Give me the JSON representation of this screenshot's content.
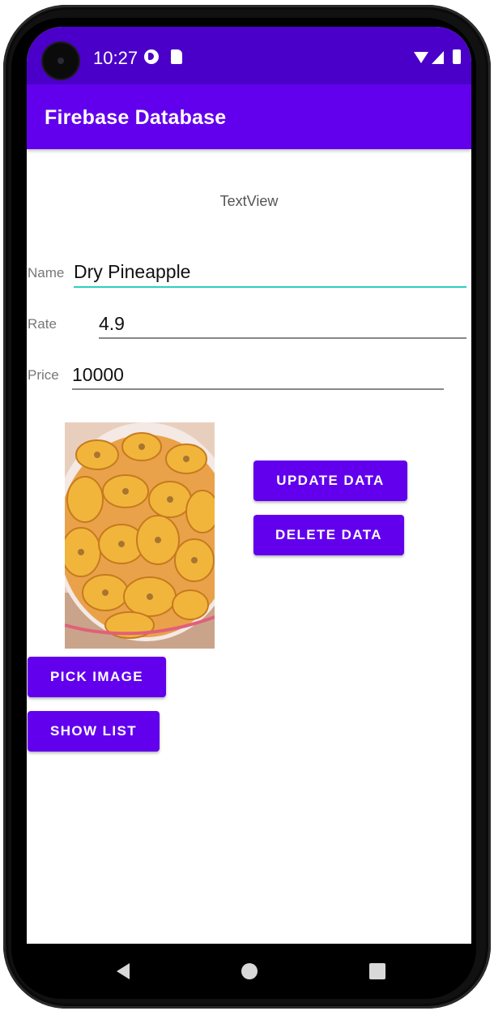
{
  "status_bar": {
    "time": "10:27",
    "icons": [
      "app-notification-icon",
      "sd-card-icon",
      "wifi-icon",
      "signal-icon",
      "battery-icon"
    ]
  },
  "app_bar": {
    "title": "Firebase Database",
    "color": "#6200ee"
  },
  "main": {
    "textview": "TextView",
    "name_label": "Name",
    "name_value": "Dry Pineapple",
    "rate_label": "Rate",
    "rate_value": "4.9",
    "price_label": "Price",
    "price_value": "10000",
    "image": "dried-fruit-chips-photo"
  },
  "buttons": {
    "update": "UPDATE DATA",
    "delete": "DELETE DATA",
    "pick_image": "PICK IMAGE",
    "show_list": "SHOW LIST"
  },
  "nav_bar": {
    "icons": [
      "back-icon",
      "home-icon",
      "recents-icon"
    ]
  },
  "colors": {
    "primary": "#6200ee",
    "status_bar": "#4a00c8",
    "focus_accent": "#2bd0c0"
  }
}
